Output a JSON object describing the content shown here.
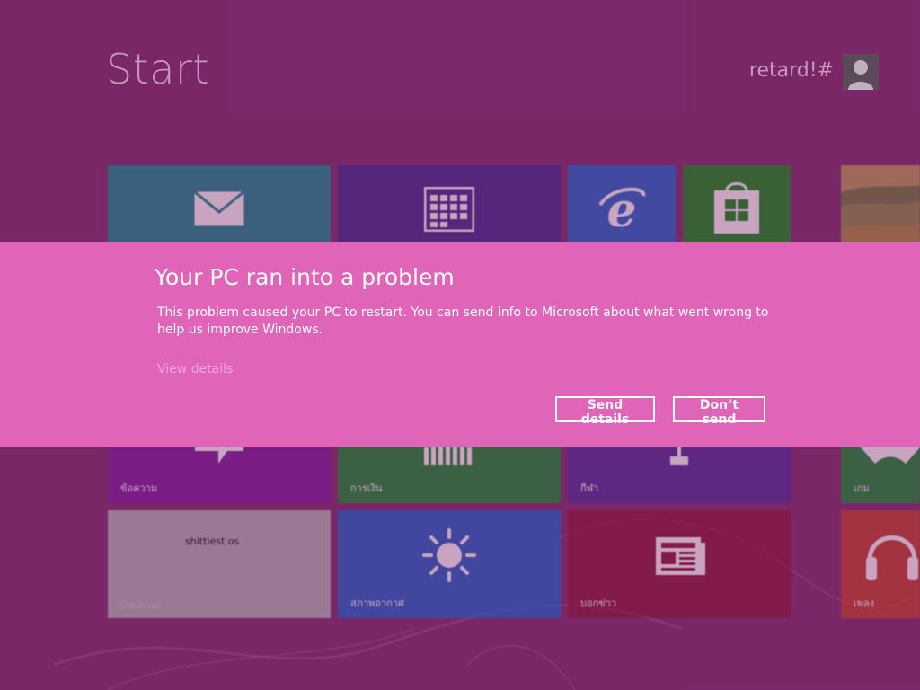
{
  "start": {
    "title": "Start",
    "user_name": "retard!#"
  },
  "tiles": {
    "mail": {
      "label": "",
      "color": "#0f8a8d"
    },
    "calendar": {
      "label": "",
      "color": "#3b2a8d"
    },
    "ie": {
      "label": "",
      "color": "#1b66c9"
    },
    "store": {
      "label": "",
      "color": "#108a16"
    },
    "photos": {
      "label": ""
    },
    "messaging": {
      "label": "ข้อความ",
      "color": "#7a1a9a"
    },
    "finance": {
      "label": "การเงิน",
      "color": "#138a2c"
    },
    "sports": {
      "label": "กีฬา",
      "color": "#4c2a94"
    },
    "games": {
      "label": "เกม",
      "color": "#138a2c"
    },
    "desktop": {
      "label": "Desktop",
      "caption": "shittiest os",
      "color": "#b3b3b3"
    },
    "weather": {
      "label": "สภาพอากาศ",
      "color": "#1b5fc4"
    },
    "news": {
      "label": "บอกข่าว",
      "color": "#8a1838"
    },
    "music": {
      "label": "เพลง",
      "color": "#c2402a"
    }
  },
  "dialog": {
    "title": "Your PC ran into a problem",
    "body": "This problem caused your PC to restart. You can send info to Microsoft about what went wrong to help us improve Windows.",
    "view_details": "View details",
    "send_label": "Send details",
    "dont_send_label": "Don’t send",
    "background_color": "#e064b8"
  }
}
